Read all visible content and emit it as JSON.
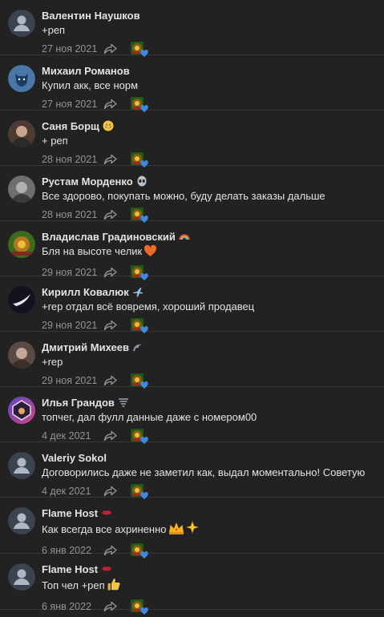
{
  "comments": [
    {
      "author": "Валентин Наушков",
      "text": "+реп",
      "date": "27 ноя 2021",
      "avatar": "default-avatar",
      "badge": null
    },
    {
      "author": "Михаил Романов",
      "text": "Купил акк, все норм",
      "date": "27 ноя 2021",
      "avatar": "vk-dog-avatar",
      "badge": null
    },
    {
      "author": "Саня Борщ",
      "text": "+ реп",
      "date": "28 ноя 2021",
      "avatar": "photo-avatar",
      "badge": "grin-emoji"
    },
    {
      "author": "Рустам Морденко",
      "text": "Все здорово, покупать можно, буду делать заказы дальше",
      "date": "28 ноя 2021",
      "avatar": "photo-avatar",
      "badge": "alien-emoji"
    },
    {
      "author": "Владислав Градиновский",
      "text": "Бля на высоте челик",
      "date": "29 ноя 2021",
      "avatar": "photo-avatar",
      "badge": "rainbow-emoji",
      "text_emoji": "orange-heart-emoji"
    },
    {
      "author": "Кирилл Ковалюк",
      "text": "+rep отдал всё вовремя, хороший продавец",
      "date": "29 ноя 2021",
      "avatar": "photo-avatar",
      "badge": "airplane-emoji"
    },
    {
      "author": "Дмитрий Михеев",
      "text": "+rep",
      "date": "29 ноя 2021",
      "avatar": "photo-avatar",
      "badge": "wave-emoji"
    },
    {
      "author": "Илья Грандов",
      "text": "топчег, дал фулл данные даже с номером00",
      "date": "4 дек 2021",
      "avatar": "photo-avatar",
      "badge": "tornado-emoji"
    },
    {
      "author": "Valeriy Sokol",
      "text": "Договорились даже не заметил как, выдал моментально! Советую",
      "date": "4 дек 2021",
      "avatar": "default-avatar",
      "badge": null
    },
    {
      "author": "Flame Host",
      "text": "Как всегда все ахриненно",
      "date": "6 янв 2022",
      "avatar": "default-avatar",
      "badge": "lips-emoji",
      "text_emoji": "crown-sparkle-emoji"
    },
    {
      "author": "Flame Host",
      "text": "Топ чел +реп",
      "date": "6 янв 2022",
      "avatar": "default-avatar",
      "badge": "lips-emoji",
      "text_emoji": "thumbs-up-emoji"
    }
  ],
  "colors": {
    "background": "#222222",
    "author": "#e1e3e6",
    "meta": "#939393",
    "separator": "#363738",
    "reaction_heart": "#3f8ae0"
  }
}
